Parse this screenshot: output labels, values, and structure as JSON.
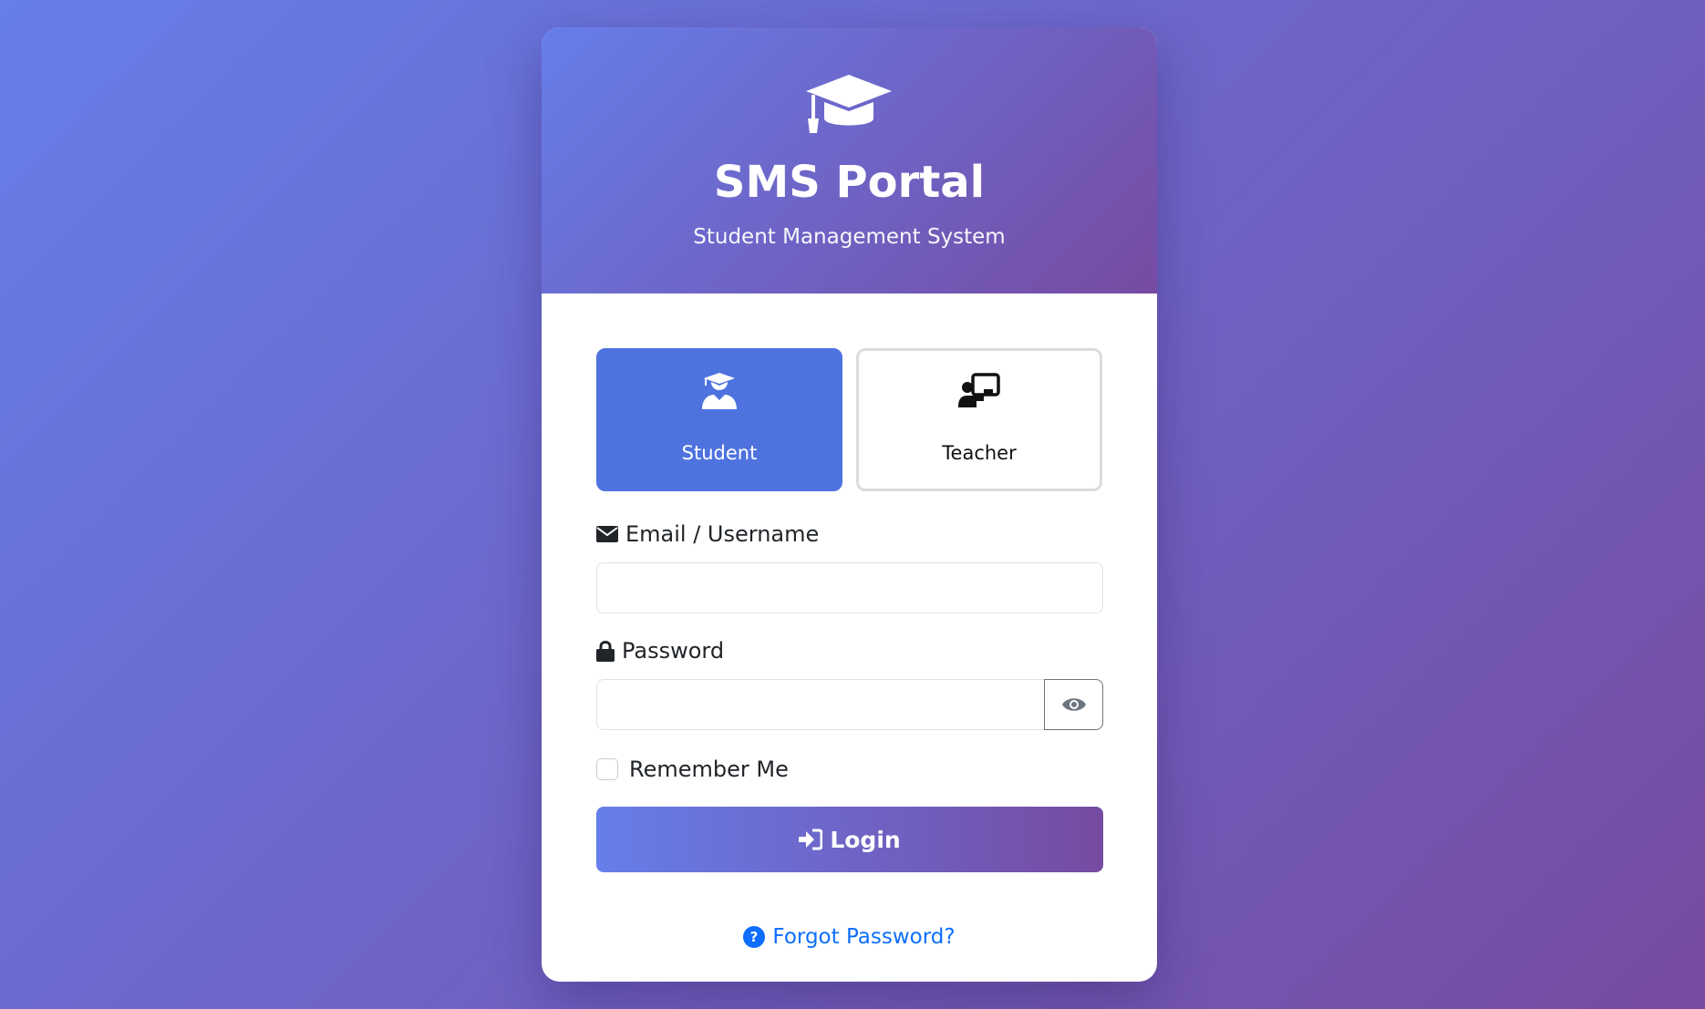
{
  "header": {
    "icon": "graduation-cap-icon",
    "title": "SMS Portal",
    "subtitle": "Student Management System"
  },
  "roles": [
    {
      "id": "student",
      "label": "Student",
      "icon": "user-graduate-icon",
      "selected": true
    },
    {
      "id": "teacher",
      "label": "Teacher",
      "icon": "chalkboard-teacher-icon",
      "selected": false
    }
  ],
  "form": {
    "email_label": "Email / Username",
    "email_icon": "envelope-icon",
    "email_value": "",
    "password_label": "Password",
    "password_icon": "lock-icon",
    "password_value": "",
    "toggle_icon": "eye-icon",
    "remember_label": "Remember Me",
    "remember_checked": false,
    "login_label": "Login",
    "login_icon": "sign-in-icon",
    "forgot_label": "Forgot Password?",
    "forgot_icon": "question-circle-icon"
  },
  "colors": {
    "gradient_start": "#667eea",
    "gradient_end": "#764ba2",
    "selected_role_bg": "#4e73df",
    "link": "#0d6efd"
  }
}
